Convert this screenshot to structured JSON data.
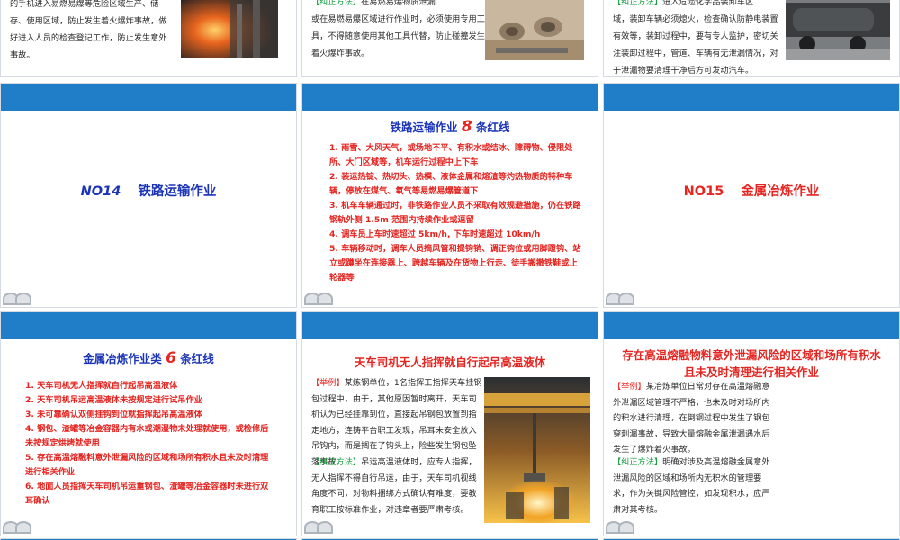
{
  "row_a": {
    "s1_text": "的手机进入易燃易爆等危险区域生产、储存、使用区域，防止发生着火爆炸事故，做好进入人员的检查登记工作，防止发生意外事故。",
    "s2_tag": "【纠正方法】",
    "s2_text_inline": "在易燃易爆物质泄漏",
    "s2_text": "或在易燃易爆区域进行作业时，必须使用专用工具，不得随意使用其他工具代替，防止碰撞发生着火爆炸事故。",
    "s3_tag": "【纠正方法】",
    "s3_text_inline": "进入危险化学品装卸车区",
    "s3_text": "域，装卸车辆必须熄火，检查确认防静电装置有效等，装卸过程中，要有专人监护，密切关注装卸过程中，管道、车辆有无泄漏情况，对于泄漏物要清理干净后方可发动汽车。"
  },
  "row_b": {
    "s1_title_no": "NO14",
    "s1_title_text": "铁路运输作业",
    "s2_title_prefix": "铁路运输作业",
    "s2_title_num": "8",
    "s2_title_suffix": "条红线",
    "s2_items": [
      "1. 雨雪、大风天气，或场地不平、有积水或结冰、障碍物、侵限处所、大门区域等，机车运行过程中上下车",
      "2. 装运热锭、热切头、热模、液体金属和熔渣等灼热物质的特种车辆，停放在煤气、氧气等易燃易爆管道下",
      "3. 机车车辆通过时，非铁路作业人员不采取有效规避措施，仍在铁路钢轨外侧 1.5m 范围内持续作业或逗留",
      "4. 调车员上车时速超过 5km/h, 下车时速超过 10km/h",
      "5. 车辆移动时，调车人员摘风管和提钩销、调正钩位或用脚蹬钩、站立或蹲坐在连接器上、跨越车辆及在货物上行走、徒手搬撤铁鞋或止轮器等"
    ],
    "s3_title_no": "NO15",
    "s3_title_text": "金属冶炼作业"
  },
  "row_c": {
    "s1_title_prefix": "金属冶炼作业类",
    "s1_title_num": "6",
    "s1_title_suffix": "条红线",
    "s1_items": [
      "1. 天车司机无人指挥就自行起吊高温液体",
      "2. 天车司机吊运高温液体未按规定进行试吊作业",
      "3. 未可靠确认双侧挂钩到位就指挥起吊高温液体",
      "4. 钢包、渣罐等冶金容器内有水或潮湿物未处理就使用，或检修后未按规定烘烤就使用",
      "5. 存在高温熔融料意外泄漏风险的区域和场所有积水且未及时清理进行相关作业",
      "6. 地面人员指挥天车司机吊运重钢包、渣罐等冶金容器时未进行双耳确认"
    ],
    "s2_title": "天车司机无人指挥就自行起吊高温液体",
    "s2_case_tag": "【举例】",
    "s2_case_text": "某炼钢单位，1名指挥工指挥天车挂钢包过程中，由于，其他原因暂时离开，天车司机认为已经挂靠到位，直接起吊钢包放置到指定地方，连铸平台职工发现，吊耳未安全放入吊钩内，而是搁在了钩头上，险些发生钢包坠落事故。",
    "s2_fix_tag": "【纠正方法】",
    "s2_fix_text": "吊运高温液体时，应专人指挥，无人指挥不得自行吊运，由于，天车司机视线角度不同，对物料捆绑方式确认有难度，要教育职工按标准作业，对违章者要严肃考核。",
    "s3_title": "存在高温熔融物料意外泄漏风险的区域和场所有积水且未及时清理进行相关作业",
    "s3_case_tag": "【举例】",
    "s3_case_text": "某冶炼单位日常对存在高温熔融意外泄漏区域管理不严格，也未及时对场所内的积水进行清理，在倒钢过程中发生了钢包穿刺漏事故，导致大量熔融金属泄漏遇水后发生了爆炸着火事故。",
    "s3_fix_tag": "【纠正方法】",
    "s3_fix_text": "明确对涉及高温熔融金属意外泄漏风险的区域和场所内无积水的管理要求，作为关键风险管控，如发现积水，应严肃对其考核。"
  }
}
